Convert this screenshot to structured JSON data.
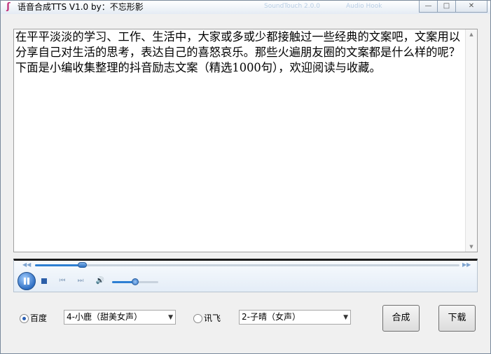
{
  "window": {
    "title": "语音合成TTS V1.0 by：不忘形影",
    "icon": "tts-app-icon",
    "ghost_labels": [
      "SoundTouch 2.0.0",
      "Audio Hook"
    ],
    "controls": {
      "minimize": "—",
      "maximize": "□",
      "close": "✕"
    }
  },
  "editor": {
    "text": "在平平淡淡的学习、工作、生活中，大家或多或少都接触过一些经典的文案吧，文案用以分享自己对生活的思考，表达自己的喜怒哀乐。那些火遍朋友圈的文案都是什么样的呢？下面是小编收集整理的抖音励志文案（精选1000句），欢迎阅读与收藏。"
  },
  "player": {
    "progress": 0.11,
    "volume": 0.5,
    "state": "playing",
    "icons": [
      "pause-icon",
      "stop-icon",
      "previous-icon",
      "next-icon",
      "volume-icon"
    ]
  },
  "engines": {
    "baidu": {
      "label": "百度",
      "selected": true,
      "voice": "4-小鹿（甜美女声）"
    },
    "xunfei": {
      "label": "讯飞",
      "selected": false,
      "voice": "2-子晴（女声）"
    }
  },
  "buttons": {
    "synthesize": "合成",
    "download": "下载"
  },
  "colors": {
    "accent": "#2d7fd3",
    "title_bar": "#e4ebf4"
  }
}
